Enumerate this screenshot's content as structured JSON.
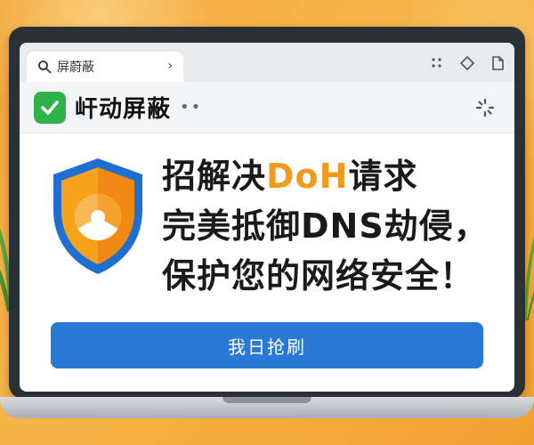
{
  "browser": {
    "tab_label": "屏蔚蔽",
    "tab_chevron": "›"
  },
  "titlebar": {
    "title": "屽动屏蔽",
    "dots": "••"
  },
  "content": {
    "headline_part1": "招解决",
    "headline_doh": "DoH",
    "headline_part2": "请求",
    "line2": "完美抵御DNS劫侵，",
    "line3": "保护您的网络安全！",
    "cta_label": "我日抢刷"
  },
  "colors": {
    "accent": "#f29a1a",
    "button": "#2a78d6",
    "check": "#2eb34a",
    "shield_blue": "#1f6fd1",
    "shield_orange": "#f7a21b"
  },
  "icons": [
    "search-icon",
    "chevron-right-icon",
    "puzzle-icon",
    "bookmark-icon",
    "page-icon",
    "checkmark-icon",
    "spinner-icon",
    "shield-icon"
  ]
}
